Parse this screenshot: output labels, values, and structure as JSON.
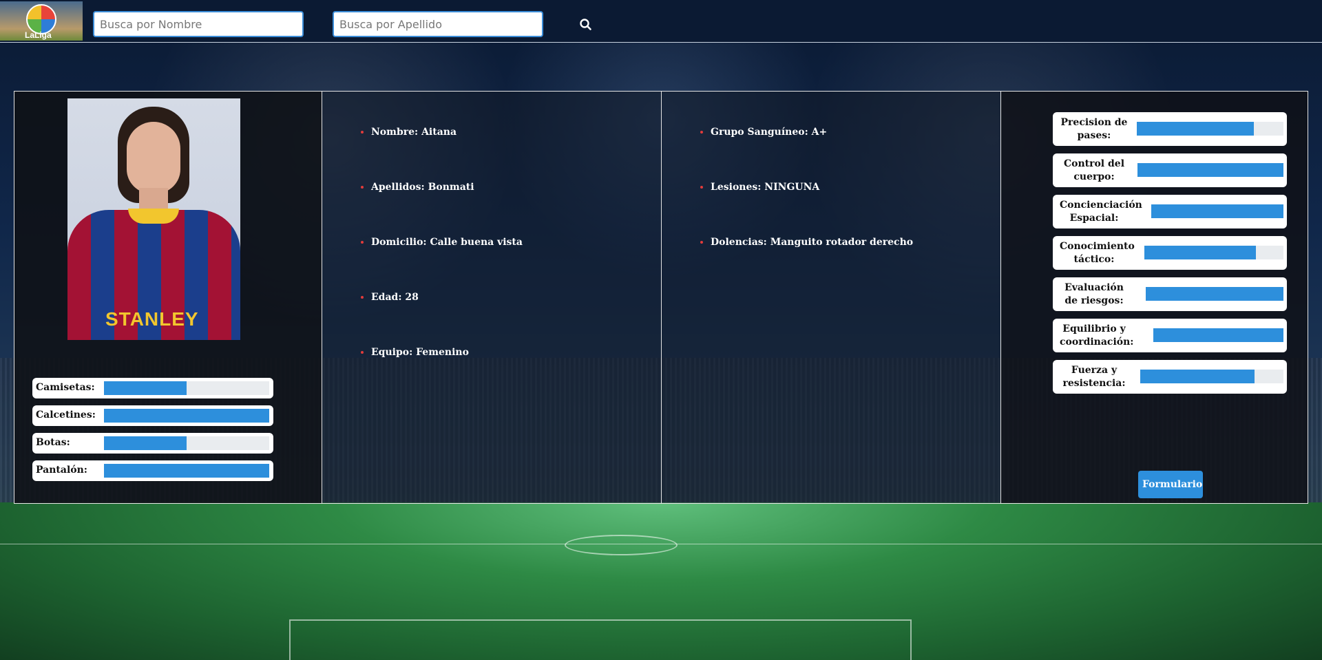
{
  "header": {
    "logo_text": "LaLiga",
    "search_name_placeholder": "Busca por Nombre",
    "search_surname_placeholder": "Busca por Apellido",
    "search_icon": "search-icon"
  },
  "kit": [
    {
      "label": "Camisetas:",
      "level": 0.5
    },
    {
      "label": "Calcetines:",
      "level": 1.0
    },
    {
      "label": "Botas:",
      "level": 0.5
    },
    {
      "label": "Pantalón:",
      "level": 1.0
    }
  ],
  "personal": [
    "Nombre: Aitana",
    "Apellidos: Bonmati",
    "Domicilio: Calle buena vista",
    "Edad: 28",
    "Equipo: Femenino"
  ],
  "medical": [
    "Grupo Sanguíneo: A+",
    "Lesiones: NINGUNA",
    "Dolencias: Manguito rotador derecho"
  ],
  "skills": [
    {
      "label": "Precision de pases:",
      "level": 0.8
    },
    {
      "label": "Control del cuerpo:",
      "level": 1.0
    },
    {
      "label": "Concienciación Espacial:",
      "level": 1.0
    },
    {
      "label": "Conocimiento táctico:",
      "level": 0.8
    },
    {
      "label": "Evaluación de riesgos:",
      "level": 1.0
    },
    {
      "label": "Equilibrio y coordinación:",
      "level": 1.0
    },
    {
      "label": "Fuerza y resistencia:",
      "level": 0.8
    }
  ],
  "form_button": "Formulario",
  "colors": {
    "accent": "#2d8fdc",
    "bullet": "#e23b3b",
    "header_bg": "#0b1a33"
  }
}
